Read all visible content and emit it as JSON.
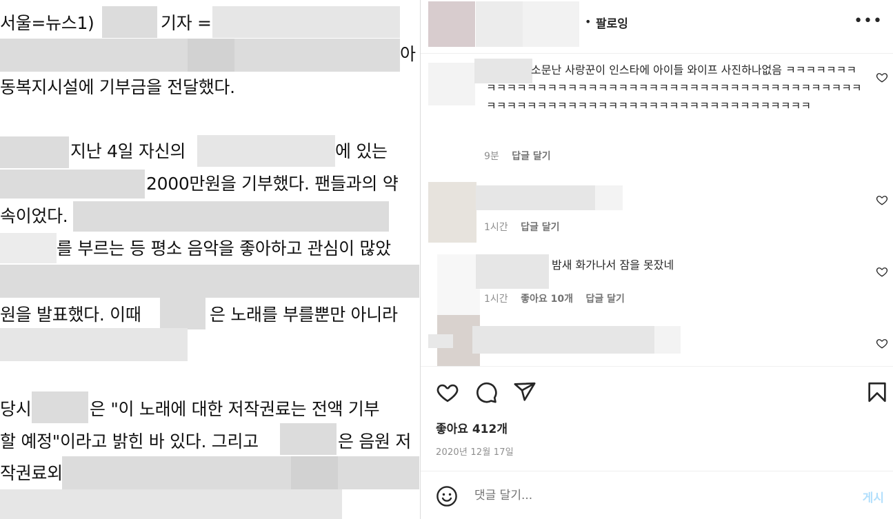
{
  "article": {
    "lines": [
      "서울=뉴스1)",
      "기자 =",
      "아",
      "동복지시설에 기부금을 전달했다.",
      "지난 4일 자신의",
      "에 있는",
      "2000만원을 기부했다. 팬들과의 약",
      "속이었다.",
      "를 부르는 등 평소 음악을 좋아하고 관심이 많았",
      "원을 발표했다. 이때",
      "은 노래를 부를뿐만 아니라",
      "당시",
      "은 \"이 노래에 대한 저작권료는 전액 기부",
      "할 예정\"이라고 밝힌 바 있다. 그리고",
      "은 음원 저",
      "작권료외"
    ]
  },
  "header": {
    "follow_label": "팔로잉",
    "dot": "•",
    "more_icon": "more-horizontal-icon"
  },
  "comments": [
    {
      "text": "소문난 사랑꾼이 인스타에 아이들 와이프 사진하나없음 ㅋㅋㅋㅋㅋㅋㅋㅋㅋㅋㅋㅋㅋㅋㅋㅋㅋㅋㅋㅋㅋㅋㅋㅋㅋㅋㅋㅋㅋㅋㅋㅋㅋㅋㅋㅋㅋㅋㅋㅋㅋㅋㅋㅋㅋㅋㅋㅋㅋㅋㅋㅋㅋㅋㅋㅋㅋㅋㅋㅋㅋㅋㅋㅋㅋㅋㅋㅋㅋㅋㅋㅋㅋㅋㅋㅋ",
      "time": "9분",
      "reply": "답글 달기"
    },
    {
      "text": "",
      "time": "1시간",
      "reply": "답글 달기"
    },
    {
      "text": "밤새 화가나서 잠을 못잤네",
      "time": "1시간",
      "likes": "좋아요 10개",
      "reply": "답글 달기"
    },
    {
      "text": ""
    }
  ],
  "actions": {
    "like_icon": "heart-icon",
    "comment_icon": "comment-bubble-icon",
    "share_icon": "paper-plane-icon",
    "save_icon": "bookmark-icon",
    "likes_text": "좋아요 412개",
    "date_text": "2020년 12월 17일"
  },
  "add_comment": {
    "placeholder": "댓글 달기...",
    "post_label": "게시",
    "post_color": "#b2dffc"
  }
}
